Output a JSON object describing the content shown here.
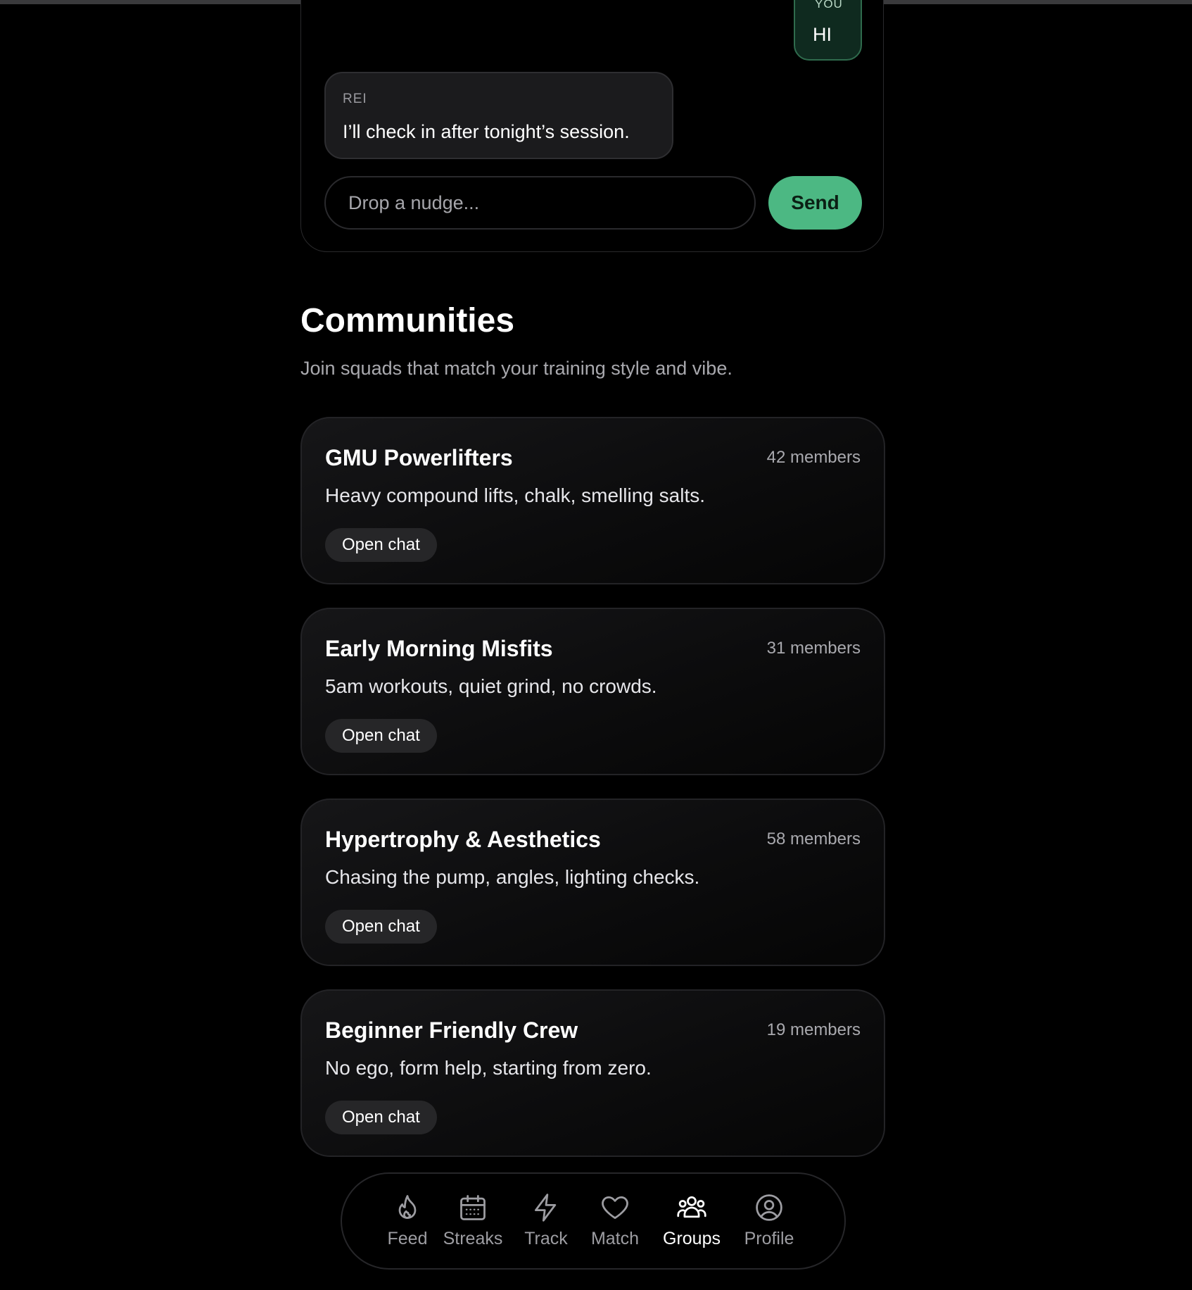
{
  "chat": {
    "my_sender": "YOU",
    "my_message": "HI",
    "their_sender": "REI",
    "their_message": "I’ll check in after tonight’s session.",
    "input_placeholder": "Drop a nudge...",
    "send_label": "Send"
  },
  "communities": {
    "title": "Communities",
    "subtitle": "Join squads that match your training style and vibe.",
    "open_chat_label": "Open chat",
    "groups": [
      {
        "name": "GMU Powerlifters",
        "members": "42 members",
        "description": "Heavy compound lifts, chalk, smelling salts."
      },
      {
        "name": "Early Morning Misfits",
        "members": "31 members",
        "description": "5am workouts, quiet grind, no crowds."
      },
      {
        "name": "Hypertrophy & Aesthetics",
        "members": "58 members",
        "description": "Chasing the pump, angles, lighting checks."
      },
      {
        "name": "Beginner Friendly Crew",
        "members": "19 members",
        "description": "No ego, form help, starting from zero."
      }
    ]
  },
  "nav": {
    "active": "Groups",
    "items": [
      {
        "label": "Feed",
        "icon": "flame-icon"
      },
      {
        "label": "Streaks",
        "icon": "calendar-icon"
      },
      {
        "label": "Track",
        "icon": "lightning-icon"
      },
      {
        "label": "Match",
        "icon": "heart-icon"
      },
      {
        "label": "Groups",
        "icon": "users-icon"
      },
      {
        "label": "Profile",
        "icon": "user-circle-icon"
      }
    ]
  },
  "colors": {
    "accent": "#4cb883",
    "background": "#000000",
    "muted_text": "#a9a9ae"
  }
}
